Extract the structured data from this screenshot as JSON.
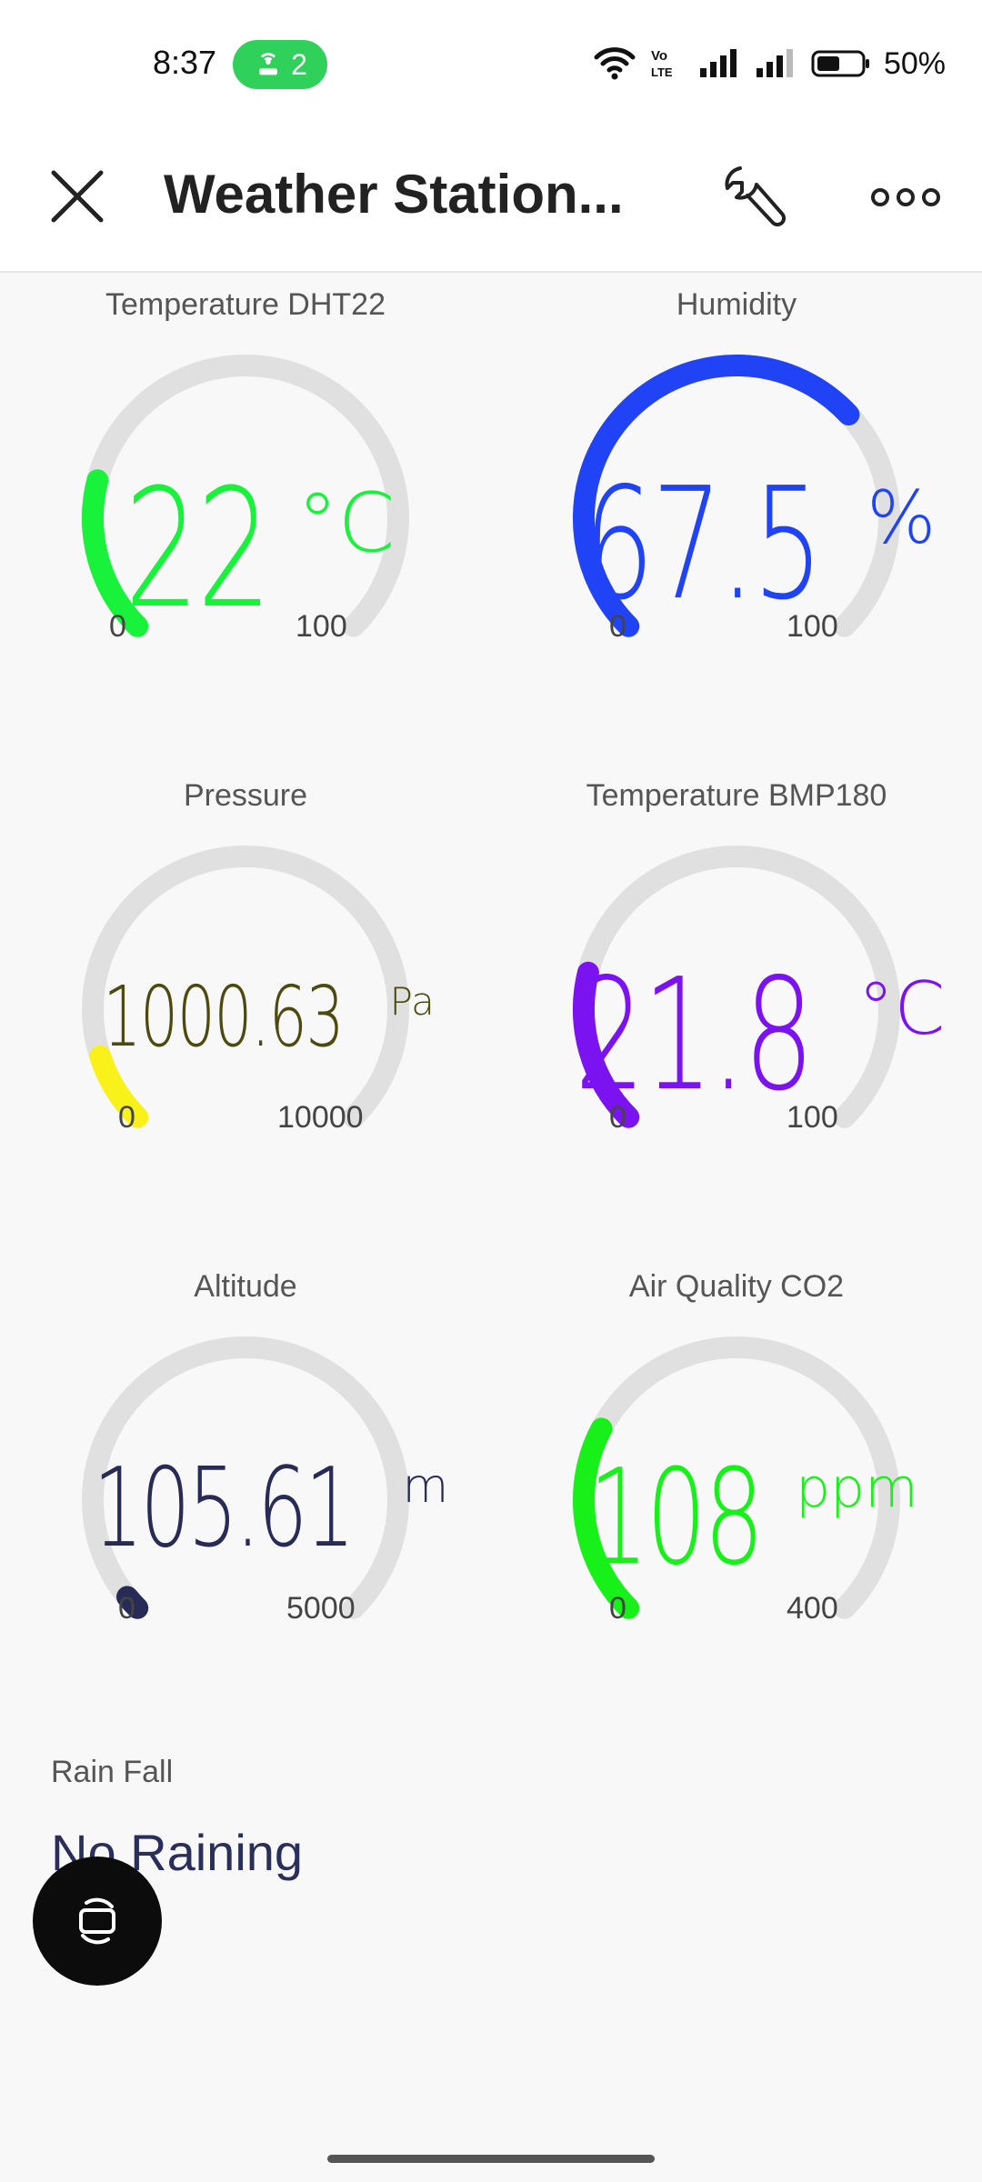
{
  "status_bar": {
    "time": "8:37",
    "hotspot_count": "2",
    "battery": "50%",
    "icons": [
      "wifi-icon",
      "volte-icon",
      "signal-icon",
      "signal-icon",
      "battery-icon"
    ]
  },
  "header": {
    "title": "Weather Station...",
    "icons": [
      "close-icon",
      "wrench-icon",
      "more-icon"
    ]
  },
  "gauges": [
    {
      "label": "Temperature DHT22",
      "value": "22",
      "unit": "°C",
      "min": "0",
      "max": "100",
      "fraction": 0.22,
      "color": "#19f23a"
    },
    {
      "label": "Humidity",
      "value": "67.5",
      "unit": "%",
      "min": "0",
      "max": "100",
      "fraction": 0.675,
      "color": "#1f43f5"
    },
    {
      "label": "Pressure",
      "value": "1000.63",
      "unit": "Pa",
      "min": "0",
      "max": "10000",
      "fraction": 0.10006,
      "color": "#f8f21a"
    },
    {
      "label": "Temperature BMP180",
      "value": "21.8",
      "unit": "°C",
      "min": "0",
      "max": "100",
      "fraction": 0.218,
      "color": "#7b12f0"
    },
    {
      "label": "Altitude",
      "value": "105.61",
      "unit": "m",
      "min": "0",
      "max": "5000",
      "fraction": 0.0211,
      "color": "#282b56"
    },
    {
      "label": "Air Quality CO2",
      "value": "108",
      "unit": "ppm",
      "min": "0",
      "max": "400",
      "fraction": 0.27,
      "color": "#18f01a"
    }
  ],
  "value_colors": [
    "#19f23a",
    "#1f43f5",
    "#4d4a10",
    "#7b12f0",
    "#282b56",
    "#18f01a"
  ],
  "rain": {
    "label": "Rain Fall",
    "value": "No Raining"
  }
}
